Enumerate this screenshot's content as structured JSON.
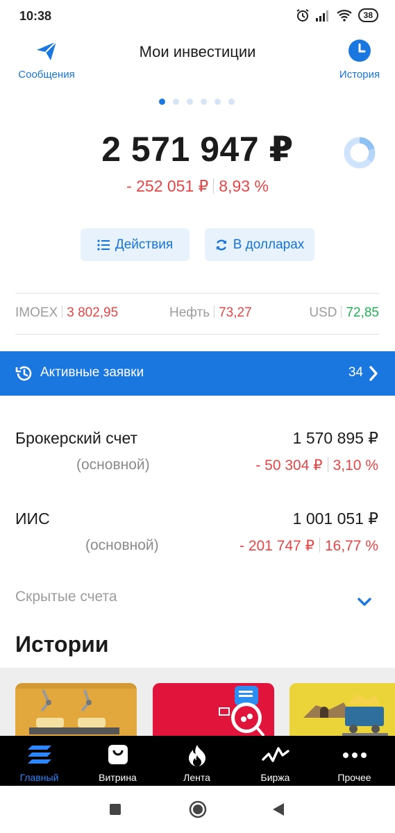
{
  "status": {
    "time": "10:38",
    "battery": "38"
  },
  "header": {
    "title": "Мои инвестиции",
    "left_label": "Сообщения",
    "right_label": "История"
  },
  "summary": {
    "total": "2 571 947 ₽",
    "change_amount": "- 252 051 ₽",
    "change_percent": "8,93 %"
  },
  "buttons": {
    "actions": "Действия",
    "in_dollars": "В долларах"
  },
  "tickers": [
    {
      "name": "IMOEX",
      "value": "3 802,95",
      "trend": "down"
    },
    {
      "name": "Нефть",
      "value": "73,27",
      "trend": "down"
    },
    {
      "name": "USD",
      "value": "72,85",
      "trend": "up"
    }
  ],
  "active_orders": {
    "label": "Активные заявки",
    "count": "34"
  },
  "accounts": [
    {
      "name": "Брокерский счет",
      "subtitle": "(основной)",
      "value": "1 570 895 ₽",
      "change_amount": "- 50 304 ₽",
      "change_percent": "3,10 %"
    },
    {
      "name": "ИИС",
      "subtitle": "(основной)",
      "value": "1 001 051 ₽",
      "change_amount": "- 201 747 ₽",
      "change_percent": "16,77 %"
    }
  ],
  "hidden_accounts": {
    "label": "Скрытые счета"
  },
  "stories": {
    "title": "Истории"
  },
  "bottom_nav": [
    {
      "label": "Главный",
      "icon": "home-stack-icon",
      "active": true
    },
    {
      "label": "Витрина",
      "icon": "shopping-bag-icon",
      "active": false
    },
    {
      "label": "Лента",
      "icon": "flame-icon",
      "active": false
    },
    {
      "label": "Биржа",
      "icon": "pulse-chart-icon",
      "active": false
    },
    {
      "label": "Прочее",
      "icon": "more-dots-icon",
      "active": false
    }
  ],
  "colors": {
    "accent": "#1a77e0",
    "negative": "#e54545",
    "positive": "#1eb050",
    "nav_background": "#000000"
  }
}
